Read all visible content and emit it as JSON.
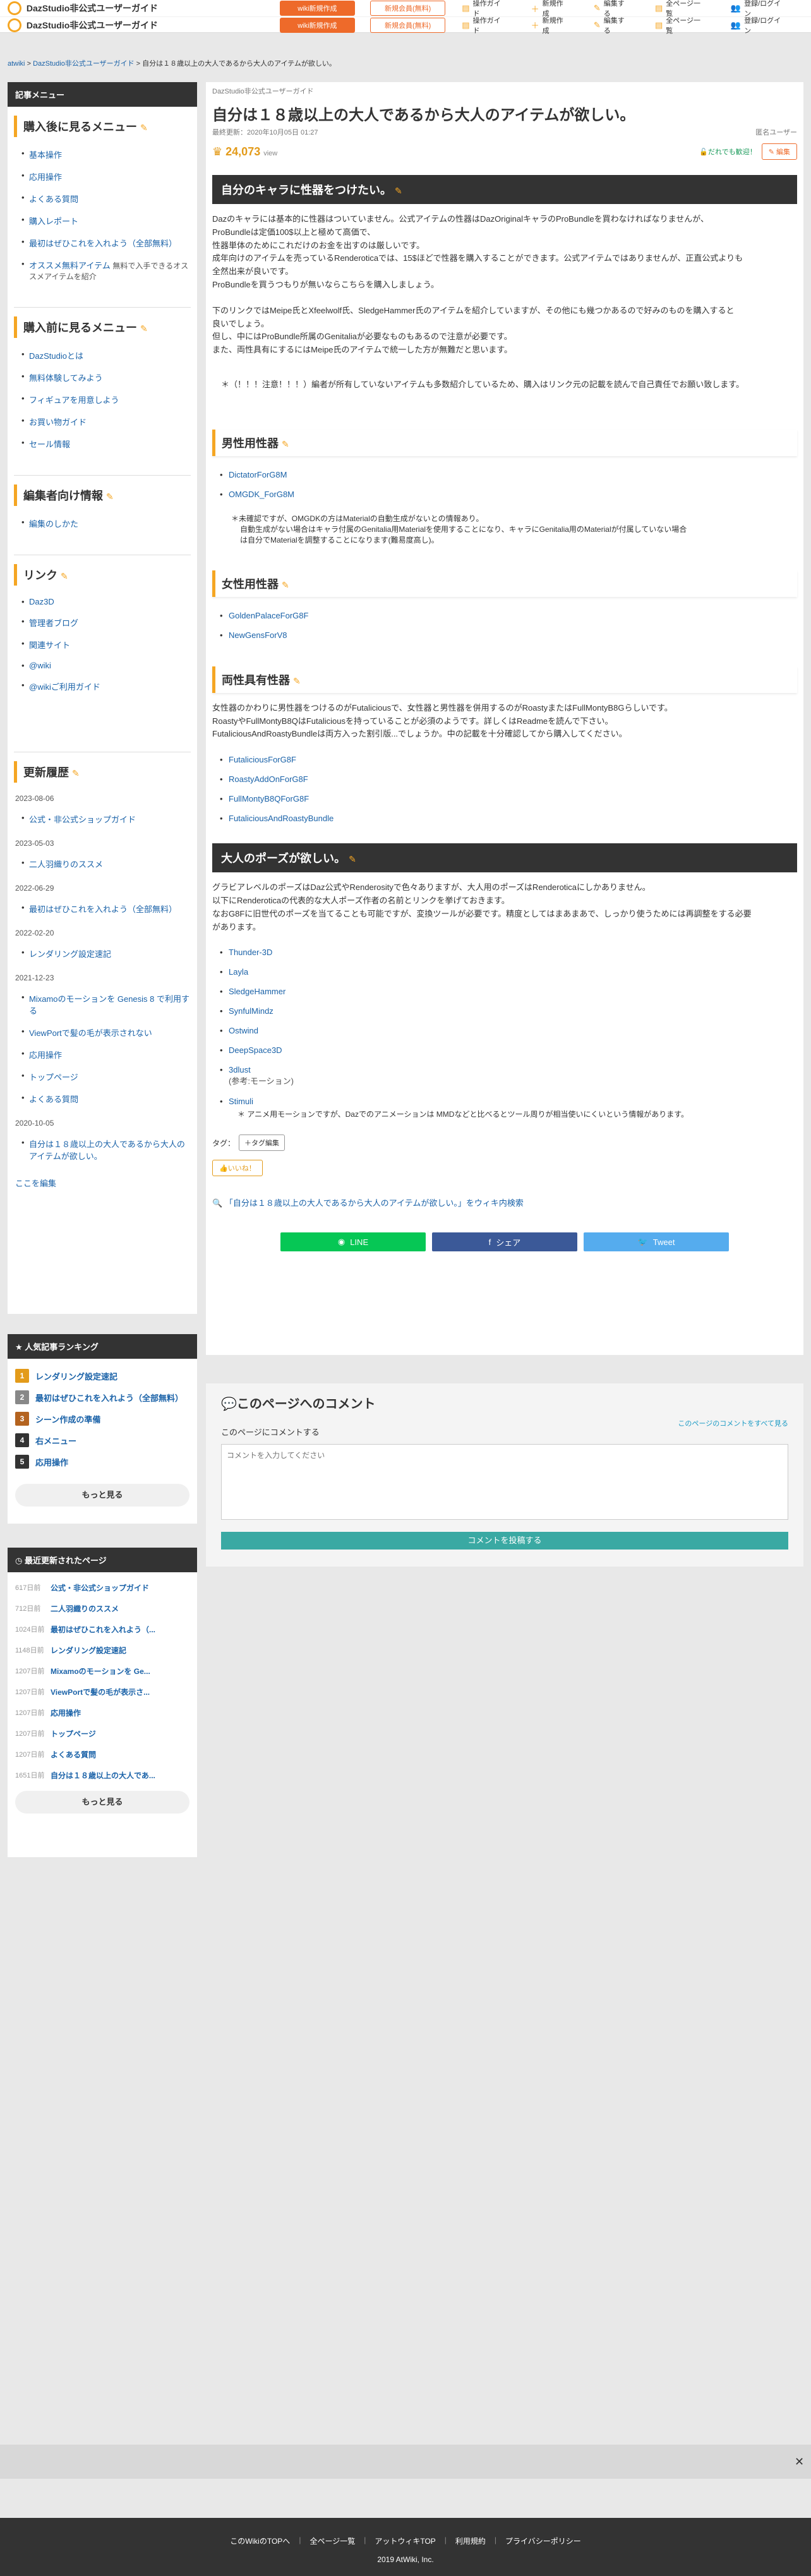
{
  "header": {
    "site_name": "DazStudio非公式ユーザーガイド",
    "wiki_btn": "wiki新規作成",
    "member_btn": "新規会員(無料)",
    "nav": [
      "操作ガイド",
      "新規作成",
      "編集する",
      "全ページ一覧",
      "登録/ログイン"
    ]
  },
  "breadcrumb": {
    "root": "atwiki",
    "site": "DazStudio非公式ユーザーガイド",
    "page": "自分は１８歳以上の大人であるから大人のアイテムが欲しい。"
  },
  "sidebar": {
    "header": "記事メニュー",
    "sec1": {
      "title": "購入後に見るメニュー",
      "items": [
        "基本操作",
        "応用操作",
        "よくある質問",
        "購入レポート",
        "最初はぜひこれを入れよう（全部無料）",
        "オススメ無料アイテム"
      ],
      "sub": "無料で入手できるオススメアイテムを紹介"
    },
    "sec2": {
      "title": "購入前に見るメニュー",
      "items": [
        "DazStudioとは",
        "無料体験してみよう",
        "フィギュアを用意しよう",
        "お買い物ガイド",
        "セール情報"
      ]
    },
    "sec3": {
      "title": "編集者向け情報",
      "items": [
        "編集のしかた"
      ]
    },
    "sec4": {
      "title": "リンク",
      "items": [
        "Daz3D",
        "管理者ブログ",
        "関連サイト",
        "@wiki",
        "@wikiご利用ガイド"
      ]
    },
    "sec5": {
      "title": "更新履歴",
      "groups": [
        {
          "date": "2023-08-06",
          "items": [
            "公式・非公式ショップガイド"
          ]
        },
        {
          "date": "2023-05-03",
          "items": [
            "二人羽織りのススメ"
          ]
        },
        {
          "date": "2022-06-29",
          "items": [
            "最初はぜひこれを入れよう（全部無料）"
          ]
        },
        {
          "date": "2022-02-20",
          "items": [
            "レンダリング設定速記"
          ]
        },
        {
          "date": "2021-12-23",
          "items": [
            "Mixamoのモーションを Genesis 8 で利用する",
            "ViewPortで髪の毛が表示されない",
            "応用操作",
            "トップページ",
            "よくある質問"
          ]
        },
        {
          "date": "2020-10-05",
          "items": [
            "自分は１８歳以上の大人であるから大人のアイテムが欲しい。"
          ]
        }
      ],
      "edit": "ここを編集"
    },
    "ranking": {
      "title": "人気記事ランキング",
      "items": [
        "レンダリング設定速記",
        "最初はぜひこれを入れよう（全部無料）",
        "シーン作成の準備",
        "右メニュー",
        "応用操作"
      ],
      "colors": [
        "#e39b1a",
        "#888888",
        "#b4631f",
        "#333333",
        "#333333"
      ],
      "more": "もっと見る"
    },
    "recent": {
      "title": "最近更新されたページ",
      "items": [
        {
          "ago": "617日前",
          "t": "公式・非公式ショップガイド"
        },
        {
          "ago": "712日前",
          "t": "二人羽織りのススメ"
        },
        {
          "ago": "1024日前",
          "t": "最初はぜひこれを入れよう（..."
        },
        {
          "ago": "1148日前",
          "t": "レンダリング設定速記"
        },
        {
          "ago": "1207日前",
          "t": "Mixamoのモーションを Ge..."
        },
        {
          "ago": "1207日前",
          "t": "ViewPortで髪の毛が表示さ..."
        },
        {
          "ago": "1207日前",
          "t": "応用操作"
        },
        {
          "ago": "1207日前",
          "t": "トップページ"
        },
        {
          "ago": "1207日前",
          "t": "よくある質問"
        },
        {
          "ago": "1651日前",
          "t": "自分は１８歳以上の大人であ..."
        }
      ],
      "more": "もっと見る"
    }
  },
  "main": {
    "site": "DazStudio非公式ユーザーガイド",
    "title": "自分は１８歳以上の大人であるから大人のアイテムが欲しい。",
    "updated": "最終更新：2020年10月05日 01:27",
    "author": "匿名ユーザー",
    "views": "24,073",
    "views_unit": "view",
    "new_label": "だれでも歓迎！",
    "edit_label": "編集",
    "s1": {
      "title": "自分のキャラに性器をつけたい。",
      "p1": [
        "Dazのキャラには基本的に性器はついていません。公式アイテムの性器はDazOriginalキャラのProBundleを買わなければなりませんが、",
        "ProBundleは定価100$以上と極めて高価で、",
        "性器単体のためにこれだけのお金を出すのは厳しいです。",
        "成年向けのアイテムを売っているRenderoticaでは、15$ほどで性器を購入することができます。公式アイテムではありませんが、正直公式よりも",
        "全然出来が良いです。",
        "ProBundleを買うつもりが無いならこちらを購入しましょう。"
      ],
      "p2": [
        "下のリンクではMeipe氏とXfeelwolf氏、SledgeHammer氏のアイテムを紹介していますが、その他にも幾つかあるので好みのものを購入すると",
        "良いでしょう。",
        "但し、中にはProBundle所属のGenitaliaが必要なものもあるので注意が必要です。",
        "また、両性具有にするにはMeipe氏のアイテムで統一した方が無難だと思います。"
      ],
      "warn": "＊（！！！注意！！！）編者が所有していないアイテムも多数紹介しているため、購入はリンク元の記載を読んで自己責任でお願い致します。"
    },
    "male": {
      "title": "男性用性器",
      "items": [
        "DictatorForG8M",
        "OMGDK_ForG8M"
      ],
      "note": [
        "＊未確認ですが、OMGDKの方はMaterialの自動生成がないとの情報あり。",
        "自動生成がない場合はキャラ付属のGenitalia用Materialを使用することになり、キャラにGenitalia用のMaterialが付属していない場合",
        "は自分でMaterialを調整することになります(難易度高し)。"
      ]
    },
    "female": {
      "title": "女性用性器",
      "items": [
        "GoldenPalaceForG8F",
        "NewGensForV8"
      ]
    },
    "both": {
      "title": "両性具有性器",
      "p": [
        "女性器のかわりに男性器をつけるのがFutaliciousで、女性器と男性器を併用するのがRoastyまたはFullMontyB8Gらしいです。",
        "RoastyやFullMontyB8QはFutaliciousを持っていることが必須のようです。詳しくはReadmeを読んで下さい。",
        "FutaliciousAndRoastyBundleは両方入った割引版...でしょうか。中の記載を十分確認してから購入してください。"
      ],
      "items": [
        "FutaliciousForG8F",
        "RoastyAddOnForG8F",
        "FullMontyB8QForG8F",
        "FutaliciousAndRoastyBundle"
      ]
    },
    "s2": {
      "title": "大人のポーズが欲しい。",
      "p": [
        "グラビアレベルのポーズはDaz公式やRenderosityで色々ありますが、大人用のポーズはRenderoticaにしかありません。",
        "以下にRenderoticaの代表的な大人ポーズ作者の名前とリンクを挙げておきます。",
        "なおG8Fに旧世代のポーズを当てることも可能ですが、変換ツールが必要です。精度としてはまあまあで、しっかり使うためには再調整をする必要",
        "があります。"
      ],
      "items": [
        "Thunder-3D",
        "Layla",
        "SledgeHammer",
        "SynfulMindz",
        "Ostwind",
        "DeepSpace3D",
        "3dlust",
        "Stimuli"
      ],
      "sub3dlust": "(参考:モーション)",
      "note": "＊ アニメ用モーションですが、Dazでのアニメーションは MMDなどと比べるとツール周りが相当使いにくいという情報があります。"
    },
    "tag_label": "タグ：",
    "tag_btn": "＋タグ編集",
    "like": "いいね！",
    "search": "「自分は１８歳以上の大人であるから大人のアイテムが欲しい。」をウィキ内検索",
    "share": {
      "line": "LINE",
      "fb": "シェア",
      "tw": "Tweet"
    }
  },
  "comment": {
    "title": "このページへのコメント",
    "all": "このページのコメントをすべて見る",
    "label": "このページにコメントする",
    "placeholder": "コメントを入力してください",
    "post": "コメントを投稿する"
  },
  "footer": {
    "links": [
      "このWikiのTOPへ",
      "全ページ一覧",
      "アットウィキTOP",
      "利用規約",
      "プライバシーポリシー"
    ],
    "copy": "2019 AtWiki, Inc."
  }
}
